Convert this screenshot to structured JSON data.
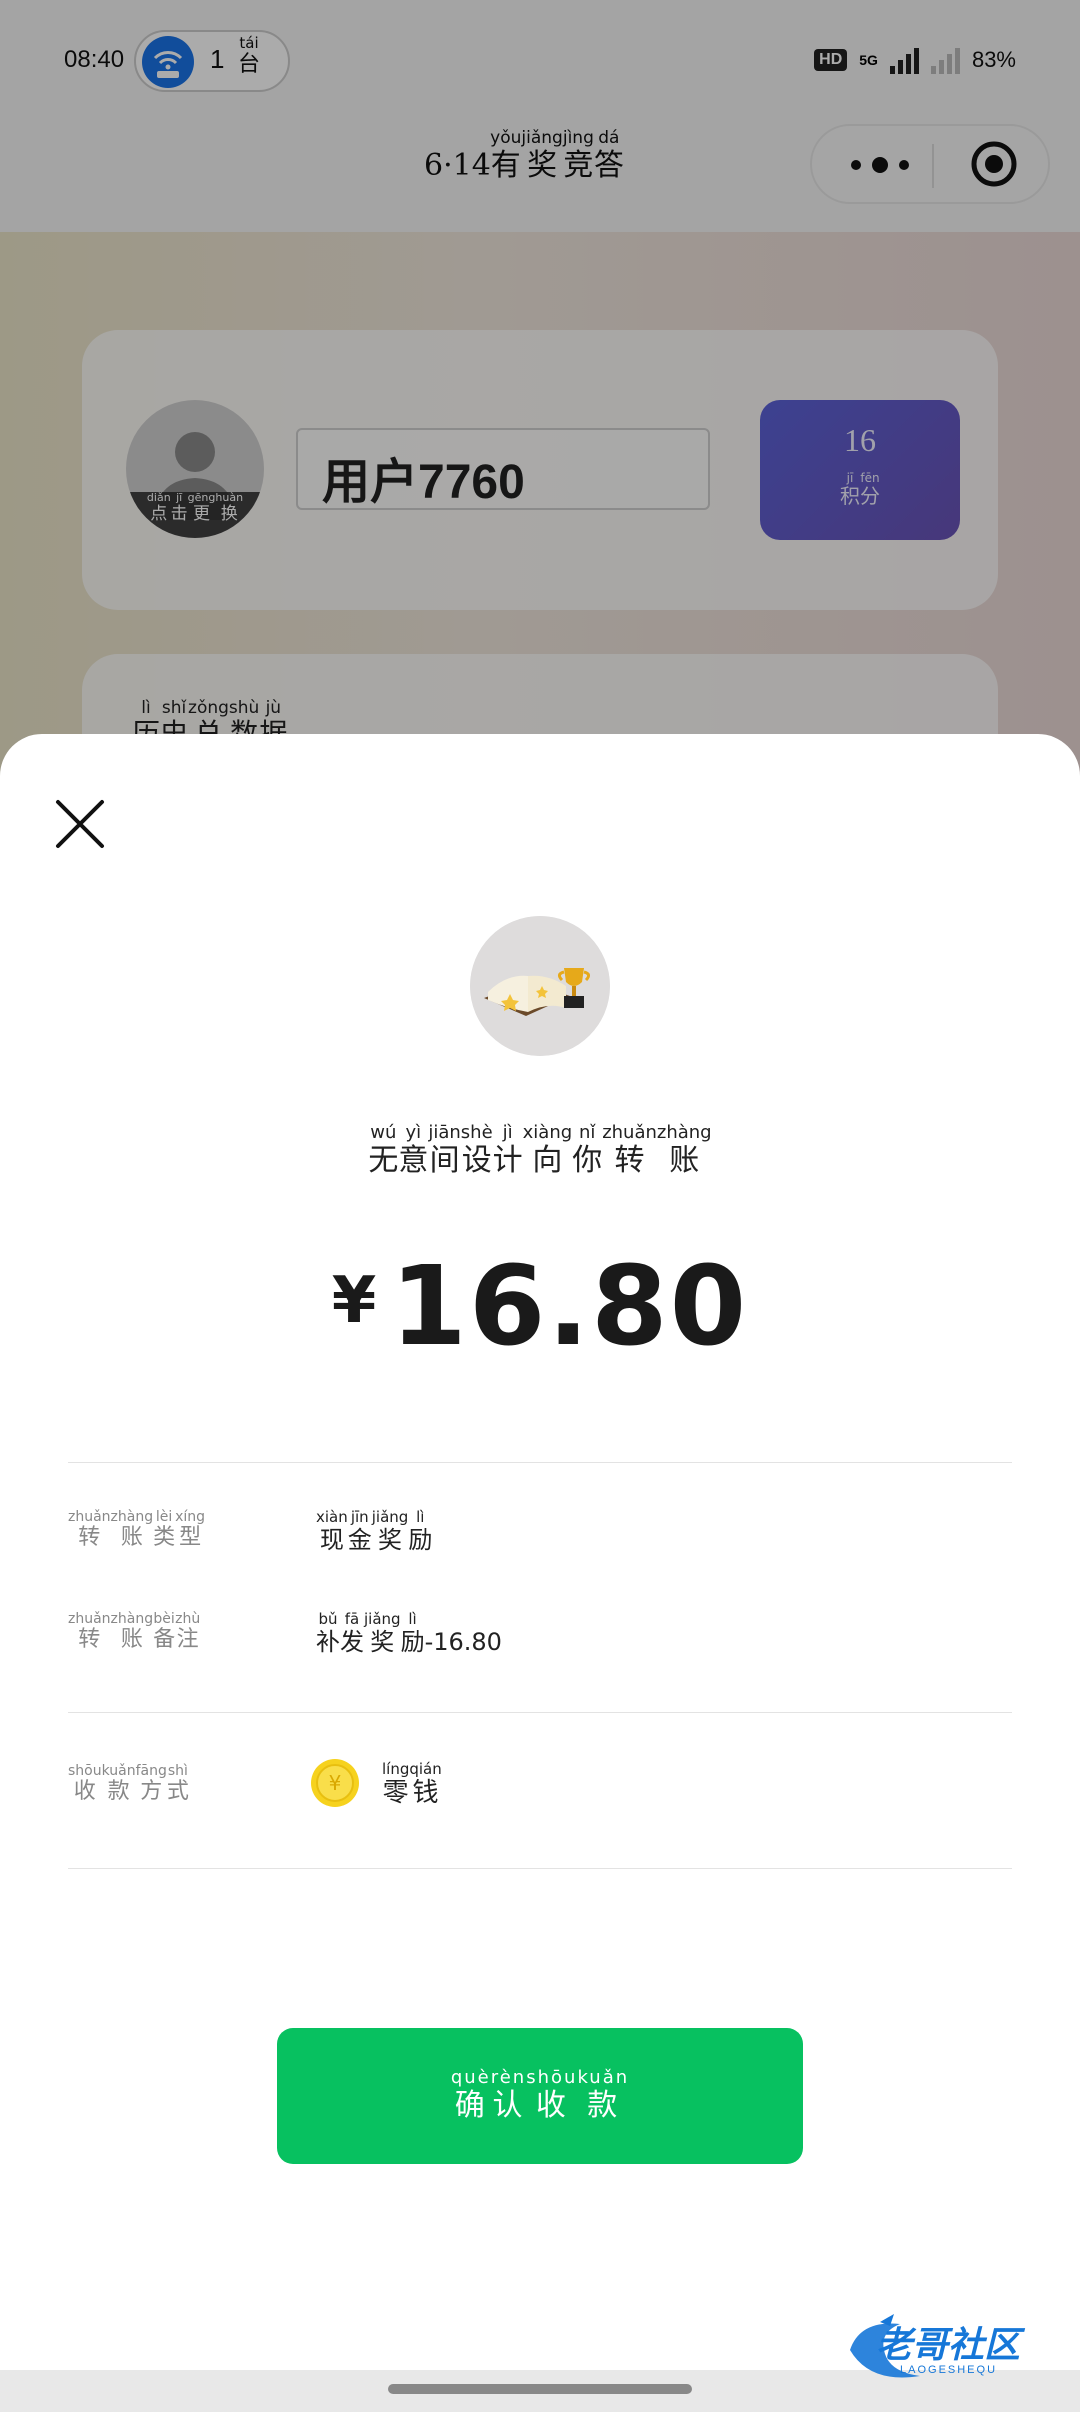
{
  "status_bar": {
    "time": "08:40",
    "hotspot_count": "1",
    "hotspot_unit": "台",
    "hotspot_unit_pinyin": "tái",
    "network_type": "5G",
    "hd_label": "HD",
    "battery": "83%"
  },
  "header": {
    "title_prefix": "6·14",
    "title": [
      {
        "char": "有",
        "pinyin": "yǒu"
      },
      {
        "char": "奖",
        "pinyin": "jiǎng"
      },
      {
        "char": "竞",
        "pinyin": "jìng"
      },
      {
        "char": "答",
        "pinyin": "dá"
      }
    ]
  },
  "profile": {
    "username": "用户7760",
    "avatar_caption": [
      {
        "char": "点",
        "pinyin": "diǎn"
      },
      {
        "char": "击",
        "pinyin": "jī"
      },
      {
        "char": "更",
        "pinyin": "gēng"
      },
      {
        "char": "换",
        "pinyin": "huàn"
      }
    ],
    "points_value": "16",
    "points_label": [
      {
        "char": "积",
        "pinyin": "jī"
      },
      {
        "char": "分",
        "pinyin": "fēn"
      }
    ]
  },
  "history": {
    "title": [
      {
        "char": "历",
        "pinyin": "lì"
      },
      {
        "char": "史",
        "pinyin": "shǐ"
      },
      {
        "char": "总",
        "pinyin": "zǒng"
      },
      {
        "char": "数",
        "pinyin": "shù"
      },
      {
        "char": "据",
        "pinyin": "jù"
      }
    ]
  },
  "transfer": {
    "sender_text": [
      {
        "char": "无",
        "pinyin": "wú"
      },
      {
        "char": "意",
        "pinyin": "yì"
      },
      {
        "char": "间",
        "pinyin": "jiān"
      },
      {
        "char": "设",
        "pinyin": "shè"
      },
      {
        "char": "计",
        "pinyin": "jì"
      },
      {
        "char": "向",
        "pinyin": "xiàng"
      },
      {
        "char": "你",
        "pinyin": "nǐ"
      },
      {
        "char": "转",
        "pinyin": "zhuǎn"
      },
      {
        "char": "账",
        "pinyin": "zhàng"
      }
    ],
    "currency": "¥",
    "amount": "16.80",
    "details": [
      {
        "label": [
          {
            "char": "转",
            "pinyin": "zhuǎn"
          },
          {
            "char": "账",
            "pinyin": "zhàng"
          },
          {
            "char": "类",
            "pinyin": "lèi"
          },
          {
            "char": "型",
            "pinyin": "xíng"
          }
        ],
        "value": [
          {
            "char": "现",
            "pinyin": "xiàn"
          },
          {
            "char": "金",
            "pinyin": "jīn"
          },
          {
            "char": "奖",
            "pinyin": "jiǎng"
          },
          {
            "char": "励",
            "pinyin": "lì"
          }
        ],
        "suffix": ""
      },
      {
        "label": [
          {
            "char": "转",
            "pinyin": "zhuǎn"
          },
          {
            "char": "账",
            "pinyin": "zhàng"
          },
          {
            "char": "备",
            "pinyin": "bèi"
          },
          {
            "char": "注",
            "pinyin": "zhù"
          }
        ],
        "value": [
          {
            "char": "补",
            "pinyin": "bǔ"
          },
          {
            "char": "发",
            "pinyin": "fā"
          },
          {
            "char": "奖",
            "pinyin": "jiǎng"
          },
          {
            "char": "励",
            "pinyin": "lì"
          }
        ],
        "suffix": "-16.80"
      }
    ],
    "method_label": [
      {
        "char": "收",
        "pinyin": "shōu"
      },
      {
        "char": "款",
        "pinyin": "kuǎn"
      },
      {
        "char": "方",
        "pinyin": "fāng"
      },
      {
        "char": "式",
        "pinyin": "shì"
      }
    ],
    "method_value": [
      {
        "char": "零",
        "pinyin": "líng"
      },
      {
        "char": "钱",
        "pinyin": "qián"
      }
    ],
    "coin_symbol": "¥",
    "confirm_label": [
      {
        "char": "确",
        "pinyin": "què"
      },
      {
        "char": "认",
        "pinyin": "rèn"
      },
      {
        "char": "收",
        "pinyin": "shōu"
      },
      {
        "char": "款",
        "pinyin": "kuǎn"
      }
    ]
  },
  "watermark": {
    "text": "老哥社区",
    "subtext": "LAOGESHEQU"
  },
  "colors": {
    "confirm_green": "#07c160",
    "points_purple": "#5b62d8",
    "hotspot_blue": "#1a73e8",
    "coin_yellow": "#f6d21e"
  },
  "icons": {
    "close": "close-icon",
    "more": "more-dots-icon",
    "target": "target-icon",
    "hotspot": "wifi-hotspot-icon",
    "coin": "coin-icon",
    "sender_avatar": "book-trophy-icon",
    "profile_avatar": "default-avatar-icon"
  }
}
